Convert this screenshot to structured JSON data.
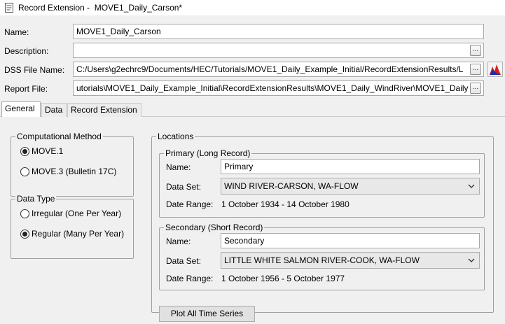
{
  "window": {
    "title": "Record Extension -  MOVE1_Daily_Carson*"
  },
  "form": {
    "name_label": "Name:",
    "name_value": "MOVE1_Daily_Carson",
    "description_label": "Description:",
    "description_value": "",
    "dss_label": "DSS File Name:",
    "dss_value": "C:/Users\\g2echrc9/Documents/HEC/Tutorials/MOVE1_Daily_Example_Initial/RecordExtensionResults/L",
    "report_label": "Report File:",
    "report_value": "utorials\\MOVE1_Daily_Example_Initial\\RecordExtensionResults\\MOVE1_Daily_WindRiver\\MOVE1_Daily",
    "browse_label": "..."
  },
  "tabs": [
    {
      "label": "General"
    },
    {
      "label": "Data"
    },
    {
      "label": "Record Extension"
    }
  ],
  "computational_method": {
    "title": "Computational Method",
    "options": [
      {
        "label": "MOVE.1",
        "selected": true
      },
      {
        "label": "MOVE.3 (Bulletin 17C)",
        "selected": false
      }
    ]
  },
  "data_type": {
    "title": "Data Type",
    "options": [
      {
        "label": "Irregular (One Per Year)",
        "selected": false
      },
      {
        "label": "Regular (Many Per Year)",
        "selected": true
      }
    ]
  },
  "locations": {
    "title": "Locations",
    "primary": {
      "title": "Primary (Long Record)",
      "name_label": "Name:",
      "name_value": "Primary",
      "dataset_label": "Data Set:",
      "dataset_value": "WIND RIVER-CARSON, WA-FLOW",
      "date_range_label": "Date Range:",
      "date_range_value": "1 October 1934 - 14 October 1980"
    },
    "secondary": {
      "title": "Secondary (Short Record)",
      "name_label": "Name:",
      "name_value": "Secondary",
      "dataset_label": "Data Set:",
      "dataset_value": "LITTLE WHITE SALMON RIVER-COOK, WA-FLOW",
      "date_range_label": "Date Range:",
      "date_range_value": "1 October 1956 - 5 October 1977"
    },
    "plot_button_label": "Plot All Time Series"
  },
  "colors": {
    "background": "#f0f0f0",
    "chart_icon_red": "#d22020",
    "chart_icon_blue": "#1c2ea8"
  }
}
